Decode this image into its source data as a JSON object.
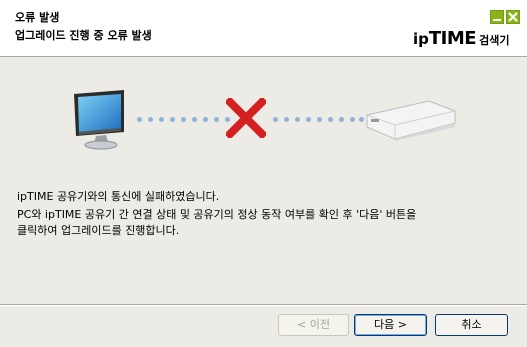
{
  "window": {
    "title": "오류 발생",
    "subtitle": "업그레이드 진행 중 오류 발생"
  },
  "brand": {
    "ip": "ip",
    "time": "TIME",
    "suffix": "검색기"
  },
  "diagram": {
    "left_icon": "computer-monitor-icon",
    "right_icon": "router-icon",
    "status_icon": "red-x-icon",
    "link_color": "#8fb3d8",
    "error_color": "#d42020"
  },
  "messages": [
    "ipTIME 공유기와의 통신에 실패하였습니다.",
    "PC와 ipTIME 공유기 간 연결 상태 및 공유기의 정상 동작 여부를 확인 후 '다음' 버튼을",
    "클릭하여 업그레이드를 진행합니다."
  ],
  "buttons": {
    "back": "< 이전",
    "next": "다음 >",
    "cancel": "취소"
  },
  "colors": {
    "accent_green": "#8ab51a"
  }
}
